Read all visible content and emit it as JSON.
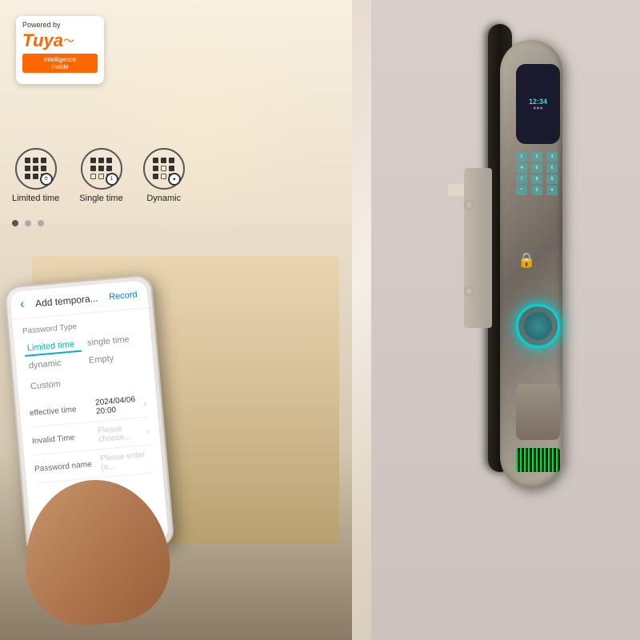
{
  "tuya": {
    "powered_by": "Powered by",
    "logo_text": "Tuya",
    "intelligence": "Intelligence\nInside"
  },
  "features": [
    {
      "label": "Limited time",
      "icon_type": "clock-grid"
    },
    {
      "label": "Single time",
      "icon_type": "single-grid"
    },
    {
      "label": "Dynamic",
      "icon_type": "dynamic-grid"
    }
  ],
  "phone_app": {
    "back_label": "‹",
    "title": "Add tempora...",
    "record_label": "Record",
    "section_label": "Password Type",
    "password_types": [
      {
        "label": "Limited time",
        "active": true
      },
      {
        "label": "single time",
        "active": false
      },
      {
        "label": "dynamic",
        "active": false
      },
      {
        "label": "Empty",
        "active": false
      },
      {
        "label": "Custom",
        "active": false
      }
    ],
    "fields": [
      {
        "label": "effective time",
        "value": "2024/04/06\n20:00",
        "placeholder": ""
      },
      {
        "label": "Invalid Time",
        "value": "",
        "placeholder": "Please choose..."
      },
      {
        "label": "Password name",
        "value": "",
        "placeholder": "Please enter (o..."
      }
    ]
  },
  "lock": {
    "time_display": "12:34",
    "keypad_keys": [
      "1",
      "2",
      "3",
      "4",
      "5",
      "6",
      "7",
      "8",
      "9",
      "*",
      "0",
      "#"
    ]
  },
  "pagination": {
    "dots": 3,
    "active": 0
  }
}
